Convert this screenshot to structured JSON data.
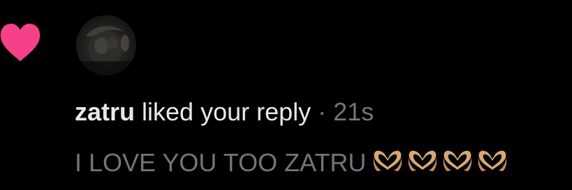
{
  "notification": {
    "type_icon": "heart-icon",
    "username": "zatru",
    "action": "liked your reply",
    "separator": "·",
    "time": "21s",
    "reply_text": "I LOVE YOU TOO ZATRU",
    "reply_emojis": [
      "heart-hands-icon",
      "heart-hands-icon",
      "heart-hands-icon",
      "heart-hands-icon"
    ]
  },
  "colors": {
    "background": "#000000",
    "heart": "#f7408a",
    "primary_text": "#e7e9ea",
    "secondary_text": "#71767b",
    "emoji_skin": "#d9a773"
  }
}
